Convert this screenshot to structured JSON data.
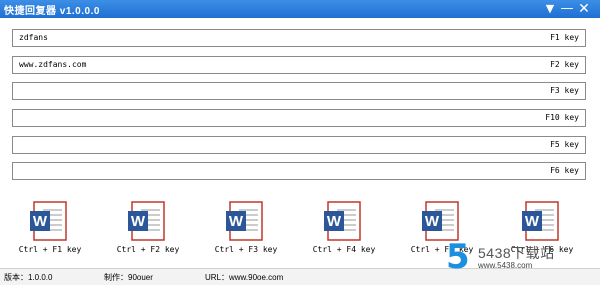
{
  "window": {
    "title": "快捷回复器 v1.0.0.0",
    "menu_glyph": "▼",
    "min_glyph": "—",
    "close_glyph": "✕"
  },
  "fields": [
    {
      "value": "zdfans",
      "key": "F1 key"
    },
    {
      "value": "www.zdfans.com",
      "key": "F2 key"
    },
    {
      "value": "",
      "key": "F3 key"
    },
    {
      "value": "",
      "key": "F10 key"
    },
    {
      "value": "",
      "key": "F5 key"
    },
    {
      "value": "",
      "key": "F6 key"
    }
  ],
  "shortcuts": [
    {
      "label": "Ctrl + F1 key",
      "icon": "word-document-icon"
    },
    {
      "label": "Ctrl + F2 key",
      "icon": "word-document-icon"
    },
    {
      "label": "Ctrl + F3 key",
      "icon": "word-document-icon"
    },
    {
      "label": "Ctrl + F4 key",
      "icon": "word-document-icon"
    },
    {
      "label": "Ctrl + F5 key",
      "icon": "word-document-icon"
    },
    {
      "label": "Ctrl + F6 key",
      "icon": "word-document-icon"
    }
  ],
  "status": {
    "version": "版本：1.0.0.0",
    "author": "制作：90ouer",
    "url": "URL：www.90oe.com"
  },
  "watermark": {
    "logo": "5",
    "brand": "5438下载站",
    "url": "www.5438.com"
  },
  "colors": {
    "titlebar": "#1f6fd2",
    "word_blue": "#2b579a",
    "doc_border": "#c0392b"
  }
}
